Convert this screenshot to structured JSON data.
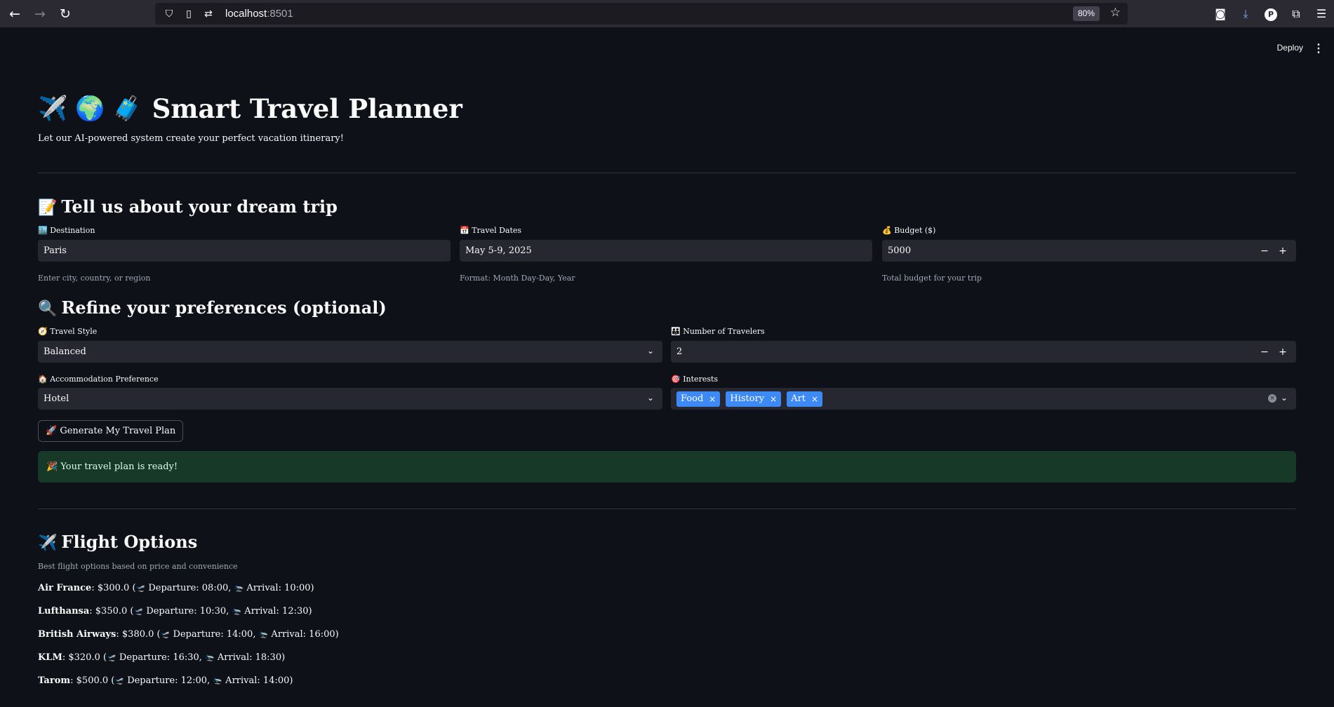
{
  "browser": {
    "url_host": "localhost",
    "url_port": ":8501",
    "zoom": "80%"
  },
  "header": {
    "deploy_label": "Deploy"
  },
  "title": {
    "emojis": "✈️ 🌍 🧳",
    "text": "Smart Travel Planner"
  },
  "subtitle": "Let our AI-powered system create your perfect vacation itinerary!",
  "trip_section": {
    "icon": "📝",
    "heading": "Tell us about your dream trip",
    "destination": {
      "label_icon": "🏙️",
      "label": "Destination",
      "value": "Paris",
      "help": "Enter city, country, or region"
    },
    "dates": {
      "label_icon": "📅",
      "label": "Travel Dates",
      "value": "May 5-9, 2025",
      "help": "Format: Month Day-Day, Year"
    },
    "budget": {
      "label_icon": "💰",
      "label": "Budget ($)",
      "value": "5000",
      "help": "Total budget for your trip"
    }
  },
  "prefs_section": {
    "icon": "🔍",
    "heading": "Refine your preferences (optional)",
    "travel_style": {
      "label_icon": "🧭",
      "label": "Travel Style",
      "value": "Balanced"
    },
    "travelers": {
      "label_icon": "👪",
      "label": "Number of Travelers",
      "value": "2"
    },
    "accommodation": {
      "label_icon": "🏠",
      "label": "Accommodation Preference",
      "value": "Hotel"
    },
    "interests": {
      "label_icon": "🎯",
      "label": "Interests",
      "tags": [
        "Food",
        "History",
        "Art"
      ]
    }
  },
  "generate_button": {
    "icon": "🚀",
    "label": "Generate My Travel Plan"
  },
  "success_message": "🎉 Your travel plan is ready!",
  "flights_section": {
    "icon": "✈️",
    "heading": "Flight Options",
    "caption": "Best flight options based on price and convenience",
    "flights": [
      {
        "airline": "Air France",
        "price": ": $300.0 (",
        "departure": " Departure: 08:00, ",
        "arrival": " Arrival: 10:00)"
      },
      {
        "airline": "Lufthansa",
        "price": ": $350.0 (",
        "departure": " Departure: 10:30, ",
        "arrival": " Arrival: 12:30)"
      },
      {
        "airline": "British Airways",
        "price": ": $380.0 (",
        "departure": " Departure: 14:00, ",
        "arrival": " Arrival: 16:00)"
      },
      {
        "airline": "KLM",
        "price": ": $320.0 (",
        "departure": " Departure: 16:30, ",
        "arrival": " Arrival: 18:30)"
      },
      {
        "airline": "Tarom",
        "price": ": $500.0 (",
        "departure": " Departure: 12:00, ",
        "arrival": " Arrival: 14:00)"
      }
    ]
  }
}
